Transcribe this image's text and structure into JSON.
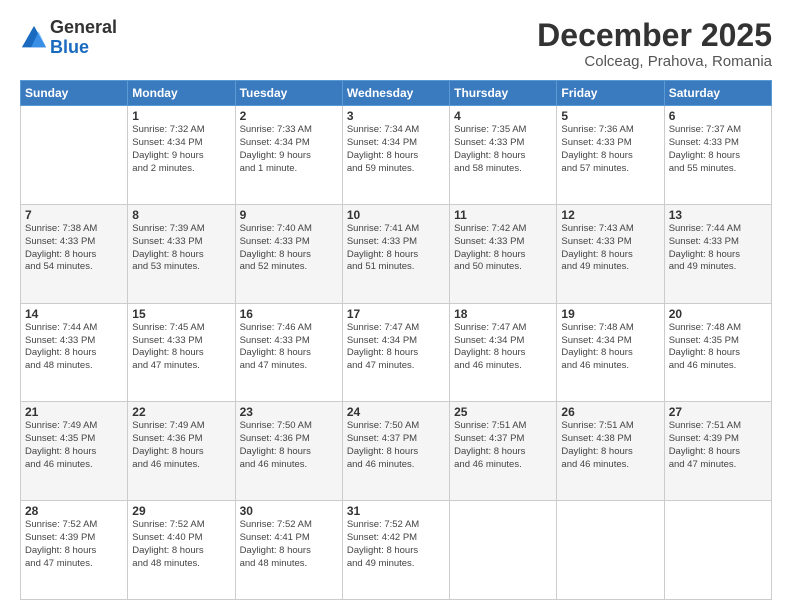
{
  "logo": {
    "general": "General",
    "blue": "Blue"
  },
  "title": "December 2025",
  "subtitle": "Colceag, Prahova, Romania",
  "days_header": [
    "Sunday",
    "Monday",
    "Tuesday",
    "Wednesday",
    "Thursday",
    "Friday",
    "Saturday"
  ],
  "weeks": [
    [
      {
        "num": "",
        "info": ""
      },
      {
        "num": "1",
        "info": "Sunrise: 7:32 AM\nSunset: 4:34 PM\nDaylight: 9 hours\nand 2 minutes."
      },
      {
        "num": "2",
        "info": "Sunrise: 7:33 AM\nSunset: 4:34 PM\nDaylight: 9 hours\nand 1 minute."
      },
      {
        "num": "3",
        "info": "Sunrise: 7:34 AM\nSunset: 4:34 PM\nDaylight: 8 hours\nand 59 minutes."
      },
      {
        "num": "4",
        "info": "Sunrise: 7:35 AM\nSunset: 4:33 PM\nDaylight: 8 hours\nand 58 minutes."
      },
      {
        "num": "5",
        "info": "Sunrise: 7:36 AM\nSunset: 4:33 PM\nDaylight: 8 hours\nand 57 minutes."
      },
      {
        "num": "6",
        "info": "Sunrise: 7:37 AM\nSunset: 4:33 PM\nDaylight: 8 hours\nand 55 minutes."
      }
    ],
    [
      {
        "num": "7",
        "info": "Sunrise: 7:38 AM\nSunset: 4:33 PM\nDaylight: 8 hours\nand 54 minutes."
      },
      {
        "num": "8",
        "info": "Sunrise: 7:39 AM\nSunset: 4:33 PM\nDaylight: 8 hours\nand 53 minutes."
      },
      {
        "num": "9",
        "info": "Sunrise: 7:40 AM\nSunset: 4:33 PM\nDaylight: 8 hours\nand 52 minutes."
      },
      {
        "num": "10",
        "info": "Sunrise: 7:41 AM\nSunset: 4:33 PM\nDaylight: 8 hours\nand 51 minutes."
      },
      {
        "num": "11",
        "info": "Sunrise: 7:42 AM\nSunset: 4:33 PM\nDaylight: 8 hours\nand 50 minutes."
      },
      {
        "num": "12",
        "info": "Sunrise: 7:43 AM\nSunset: 4:33 PM\nDaylight: 8 hours\nand 49 minutes."
      },
      {
        "num": "13",
        "info": "Sunrise: 7:44 AM\nSunset: 4:33 PM\nDaylight: 8 hours\nand 49 minutes."
      }
    ],
    [
      {
        "num": "14",
        "info": "Sunrise: 7:44 AM\nSunset: 4:33 PM\nDaylight: 8 hours\nand 48 minutes."
      },
      {
        "num": "15",
        "info": "Sunrise: 7:45 AM\nSunset: 4:33 PM\nDaylight: 8 hours\nand 47 minutes."
      },
      {
        "num": "16",
        "info": "Sunrise: 7:46 AM\nSunset: 4:33 PM\nDaylight: 8 hours\nand 47 minutes."
      },
      {
        "num": "17",
        "info": "Sunrise: 7:47 AM\nSunset: 4:34 PM\nDaylight: 8 hours\nand 47 minutes."
      },
      {
        "num": "18",
        "info": "Sunrise: 7:47 AM\nSunset: 4:34 PM\nDaylight: 8 hours\nand 46 minutes."
      },
      {
        "num": "19",
        "info": "Sunrise: 7:48 AM\nSunset: 4:34 PM\nDaylight: 8 hours\nand 46 minutes."
      },
      {
        "num": "20",
        "info": "Sunrise: 7:48 AM\nSunset: 4:35 PM\nDaylight: 8 hours\nand 46 minutes."
      }
    ],
    [
      {
        "num": "21",
        "info": "Sunrise: 7:49 AM\nSunset: 4:35 PM\nDaylight: 8 hours\nand 46 minutes."
      },
      {
        "num": "22",
        "info": "Sunrise: 7:49 AM\nSunset: 4:36 PM\nDaylight: 8 hours\nand 46 minutes."
      },
      {
        "num": "23",
        "info": "Sunrise: 7:50 AM\nSunset: 4:36 PM\nDaylight: 8 hours\nand 46 minutes."
      },
      {
        "num": "24",
        "info": "Sunrise: 7:50 AM\nSunset: 4:37 PM\nDaylight: 8 hours\nand 46 minutes."
      },
      {
        "num": "25",
        "info": "Sunrise: 7:51 AM\nSunset: 4:37 PM\nDaylight: 8 hours\nand 46 minutes."
      },
      {
        "num": "26",
        "info": "Sunrise: 7:51 AM\nSunset: 4:38 PM\nDaylight: 8 hours\nand 46 minutes."
      },
      {
        "num": "27",
        "info": "Sunrise: 7:51 AM\nSunset: 4:39 PM\nDaylight: 8 hours\nand 47 minutes."
      }
    ],
    [
      {
        "num": "28",
        "info": "Sunrise: 7:52 AM\nSunset: 4:39 PM\nDaylight: 8 hours\nand 47 minutes."
      },
      {
        "num": "29",
        "info": "Sunrise: 7:52 AM\nSunset: 4:40 PM\nDaylight: 8 hours\nand 48 minutes."
      },
      {
        "num": "30",
        "info": "Sunrise: 7:52 AM\nSunset: 4:41 PM\nDaylight: 8 hours\nand 48 minutes."
      },
      {
        "num": "31",
        "info": "Sunrise: 7:52 AM\nSunset: 4:42 PM\nDaylight: 8 hours\nand 49 minutes."
      },
      {
        "num": "",
        "info": ""
      },
      {
        "num": "",
        "info": ""
      },
      {
        "num": "",
        "info": ""
      }
    ]
  ]
}
